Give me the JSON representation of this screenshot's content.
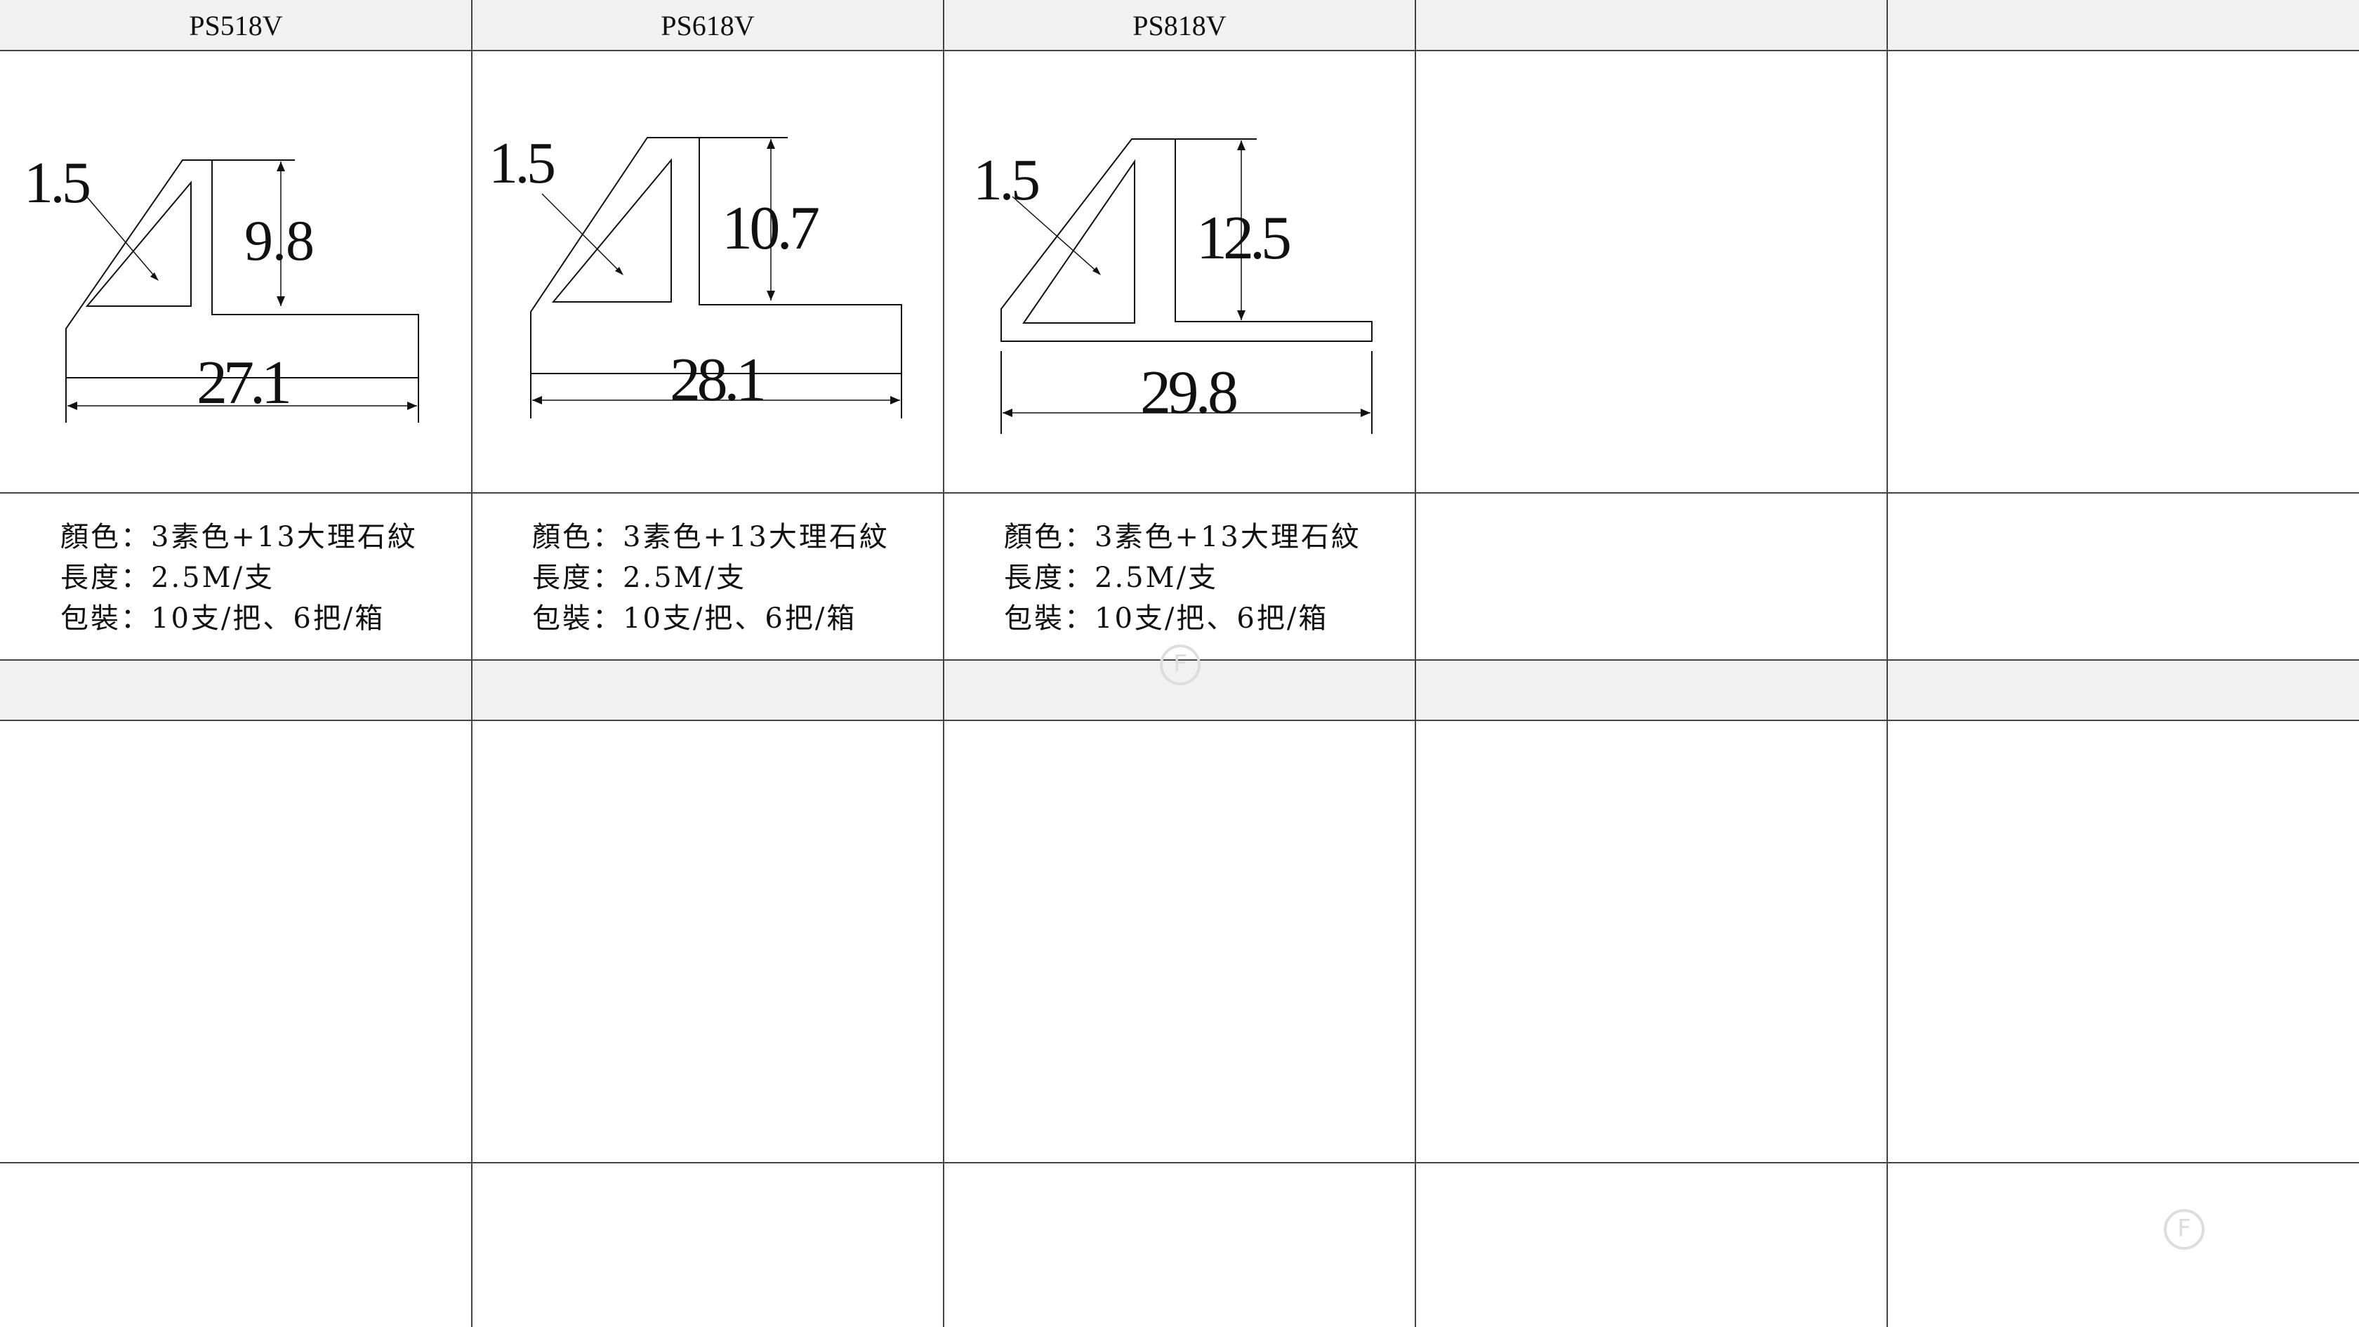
{
  "columns": [
    {
      "model": "PS518V",
      "dims": {
        "thickness": "1.5",
        "height": "9.8",
        "width": "27.1"
      },
      "specs": [
        "顏色：3素色+13大理石紋",
        "長度：2.5M/支",
        "包裝：10支/把、6把/箱"
      ]
    },
    {
      "model": "PS618V",
      "dims": {
        "thickness": "1.5",
        "height": "10.7",
        "width": "28.1"
      },
      "specs": [
        "顏色：3素色+13大理石紋",
        "長度：2.5M/支",
        "包裝：10支/把、6把/箱"
      ]
    },
    {
      "model": "PS818V",
      "dims": {
        "thickness": "1.5",
        "height": "12.5",
        "width": "29.8"
      },
      "specs": [
        "顏色：3素色+13大理石紋",
        "長度：2.5M/支",
        "包裝：10支/把、6把/箱"
      ]
    },
    {
      "model": "",
      "dims": {},
      "specs": []
    },
    {
      "model": "",
      "dims": {},
      "specs": []
    }
  ],
  "colors": {
    "header_bg": "#f1f1f1",
    "grid_line": "#444444",
    "ink": "#111111",
    "watermark": "#dddddd"
  },
  "icons": [
    "brand-watermark-icon",
    "brand-watermark-icon"
  ]
}
